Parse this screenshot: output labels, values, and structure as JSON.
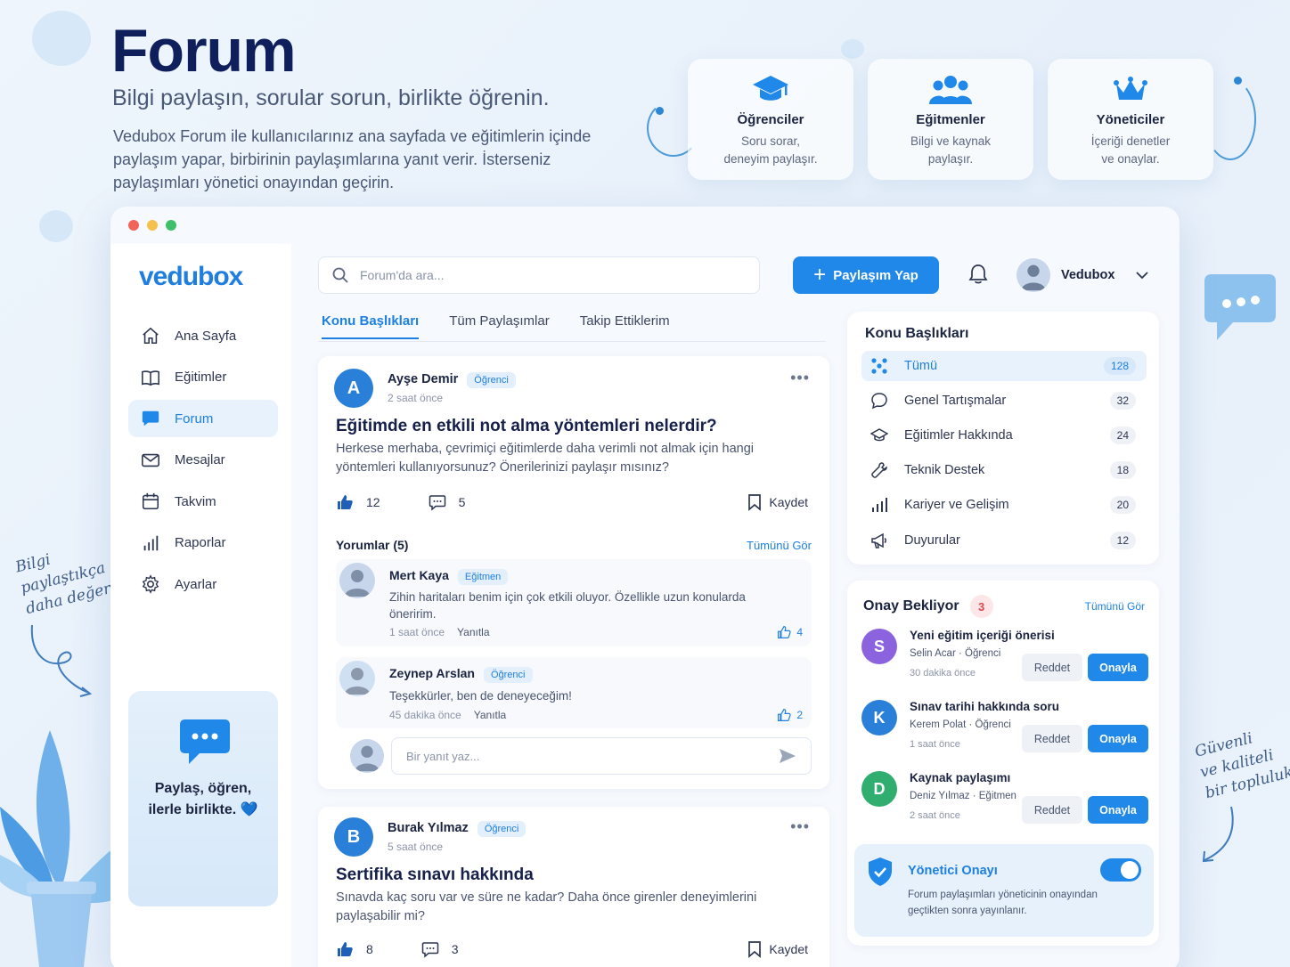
{
  "hero": {
    "title": "Forum",
    "subtitle": "Bilgi paylaşın, sorular sorun, birlikte öğrenin.",
    "description": "Vedubox Forum ile kullanıcılarınız ana sayfada ve eğitimlerin içinde paylaşım yapar, birbirinin paylaşımlarına yanıt verir. İsterseniz paylaşımları yönetici onayından geçirin."
  },
  "roles": [
    {
      "title": "Öğrenciler",
      "desc": "Soru sorar,\ndeneyim paylaşır.",
      "icon": "graduation-cap-icon"
    },
    {
      "title": "Eğitmenler",
      "desc": "Bilgi ve kaynak\npaylaşır.",
      "icon": "users-icon"
    },
    {
      "title": "Yöneticiler",
      "desc": "İçeriği denetler\nve onaylar.",
      "icon": "crown-icon"
    }
  ],
  "annotations": {
    "left": "Bilgi\npaylaştıkça\ndaha değerli",
    "right": "Güvenli\nve kaliteli\nbir topluluk"
  },
  "sidebar": {
    "logo": "vedubox",
    "items": [
      {
        "label": "Ana Sayfa",
        "icon": "home-icon"
      },
      {
        "label": "Eğitimler",
        "icon": "book-icon"
      },
      {
        "label": "Forum",
        "icon": "chat-icon",
        "active": true
      },
      {
        "label": "Mesajlar",
        "icon": "mail-icon"
      },
      {
        "label": "Takvim",
        "icon": "calendar-icon"
      },
      {
        "label": "Raporlar",
        "icon": "bar-chart-icon"
      },
      {
        "label": "Ayarlar",
        "icon": "gear-icon"
      }
    ],
    "promo": "Paylaş, öğren,\nilerle birlikte. 💙"
  },
  "topbar": {
    "search_placeholder": "Forum'da ara...",
    "share_label": "Paylaşım Yap",
    "user_name": "Vedubox"
  },
  "tabs": [
    "Konu Başlıkları",
    "Tüm Paylaşımlar",
    "Takip Ettiklerim"
  ],
  "posts": [
    {
      "initial": "A",
      "author": "Ayşe Demir",
      "role": "Öğrenci",
      "time": "2 saat önce",
      "title": "Eğitimde en etkili not alma yöntemleri nelerdir?",
      "body": "Herkese merhaba, çevrimiçi eğitimlerde daha verimli not almak için hangi yöntemleri kullanıyorsunuz? Önerilerinizi paylaşır mısınız?",
      "likes": "12",
      "comments": "5",
      "save_label": "Kaydet",
      "comments_header": "Yorumlar (5)",
      "see_all": "Tümünü Gör",
      "comment_list": [
        {
          "author": "Mert Kaya",
          "role": "Eğitmen",
          "text": "Zihin haritaları benim için çok etkili oluyor. Özellikle uzun konularda öneririm.",
          "time": "1 saat önce",
          "reply": "Yanıtla",
          "likes": "4"
        },
        {
          "author": "Zeynep Arslan",
          "role": "Öğrenci",
          "text": "Teşekkürler, ben de deneyeceğim!",
          "time": "45 dakika önce",
          "reply": "Yanıtla",
          "likes": "2"
        }
      ],
      "reply_placeholder": "Bir yanıt yaz..."
    },
    {
      "initial": "B",
      "author": "Burak Yılmaz",
      "role": "Öğrenci",
      "time": "5 saat önce",
      "title": "Sertifika sınavı hakkında",
      "body": "Sınavda kaç soru var ve süre ne kadar? Daha önce girenler deneyimlerini paylaşabilir mi?",
      "likes": "8",
      "comments": "3",
      "save_label": "Kaydet"
    }
  ],
  "topics_panel": {
    "title": "Konu Başlıkları",
    "items": [
      {
        "label": "Tümü",
        "count": "128",
        "icon": "grid-icon",
        "active": true
      },
      {
        "label": "Genel Tartışmalar",
        "count": "32",
        "icon": "chat-bubble-icon"
      },
      {
        "label": "Eğitimler Hakkında",
        "count": "24",
        "icon": "graduation-cap-icon"
      },
      {
        "label": "Teknik Destek",
        "count": "18",
        "icon": "wrench-icon"
      },
      {
        "label": "Kariyer ve Gelişim",
        "count": "20",
        "icon": "bar-chart-icon"
      },
      {
        "label": "Duyurular",
        "count": "12",
        "icon": "megaphone-icon"
      }
    ]
  },
  "pending_panel": {
    "title": "Onay Bekliyor",
    "count": "3",
    "see_all": "Tümünü Gör",
    "reject_label": "Reddet",
    "approve_label": "Onayla",
    "items": [
      {
        "initial": "S",
        "title": "Yeni eğitim içeriği önerisi",
        "sub": "Selin Acar · Öğrenci",
        "time": "30 dakika önce",
        "color": "#8b63df"
      },
      {
        "initial": "K",
        "title": "Sınav tarihi hakkında soru",
        "sub": "Kerem Polat · Öğrenci",
        "time": "1 saat önce",
        "color": "#2a7fd9"
      },
      {
        "initial": "D",
        "title": "Kaynak paylaşımı",
        "sub": "Deniz Yılmaz · Eğitmen",
        "time": "2 saat önce",
        "color": "#2fae6f"
      }
    ]
  },
  "admin_approval": {
    "title": "Yönetici Onayı",
    "desc": "Forum paylaşımları yöneticinin onayından geçtikten sonra yayınlanır.",
    "enabled": true
  },
  "colors": {
    "accent": "#1f88e8",
    "title": "#0f1f5c"
  }
}
